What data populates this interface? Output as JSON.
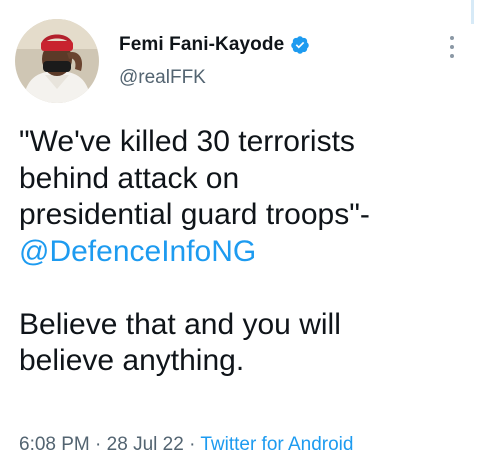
{
  "tweet": {
    "author": {
      "display_name": "Femi Fani-Kayode",
      "handle": "@realFFK",
      "verified": true,
      "avatar_icon": "avatar-photo"
    },
    "text": {
      "quote_line_1": "\"We've killed 30 terrorists",
      "quote_line_2": "behind attack on",
      "quote_line_3": "presidential guard troops\"-",
      "mention": "@DefenceInfoNG",
      "comment_line_1": "Believe that and you will",
      "comment_line_2": "believe anything."
    },
    "meta": {
      "time": "6:08 PM",
      "separator": "·",
      "date": "28 Jul 22",
      "source": "Twitter for Android"
    }
  },
  "colors": {
    "text": "#0f1419",
    "secondary": "#536471",
    "link": "#1d9bf0",
    "verified": "#1d9bf0"
  }
}
